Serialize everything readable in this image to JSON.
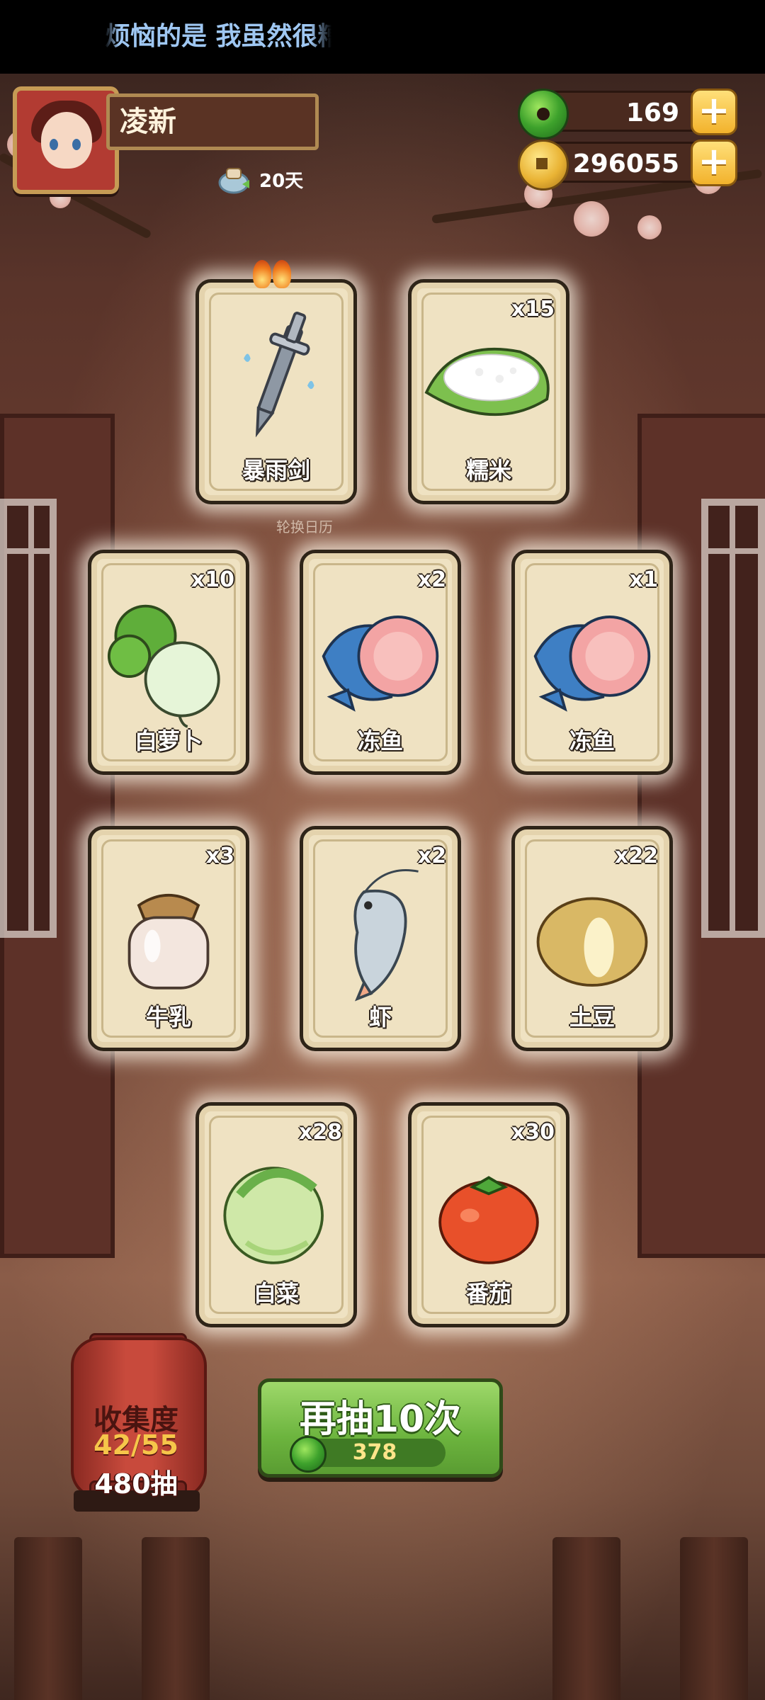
{
  "marquee": {
    "text": "烦恼的是 我虽然很糟"
  },
  "player": {
    "name": "凌新",
    "days": "20天"
  },
  "currencies": {
    "jade": {
      "value": "169",
      "plus": "+"
    },
    "coins": {
      "value": "296055",
      "plus": "+"
    }
  },
  "rotation_caption": "轮换日历",
  "cards": [
    {
      "name": "暴雨剑",
      "count": "",
      "icon": "sword-icon",
      "special": true
    },
    {
      "name": "糯米",
      "count": "x15",
      "icon": "rice-icon"
    },
    {
      "name": "白萝卜",
      "count": "x10",
      "icon": "radish-icon"
    },
    {
      "name": "冻鱼",
      "count": "x2",
      "icon": "fish-icon"
    },
    {
      "name": "冻鱼",
      "count": "x1",
      "icon": "fish-icon"
    },
    {
      "name": "牛乳",
      "count": "x3",
      "icon": "milk-jar-icon"
    },
    {
      "name": "虾",
      "count": "x2",
      "icon": "shrimp-icon"
    },
    {
      "name": "土豆",
      "count": "x22",
      "icon": "potato-icon"
    },
    {
      "name": "白菜",
      "count": "x28",
      "icon": "cabbage-icon"
    },
    {
      "name": "番茄",
      "count": "x30",
      "icon": "tomato-icon"
    }
  ],
  "collection": {
    "title": "收集度",
    "progress": "42/55",
    "draws": "480抽"
  },
  "draw_button": {
    "label": "再抽10次",
    "cost": "378"
  },
  "colors": {
    "accent_green": "#6cb43e",
    "card_bg": "#efe2c2",
    "gold": "#f2b22c"
  }
}
